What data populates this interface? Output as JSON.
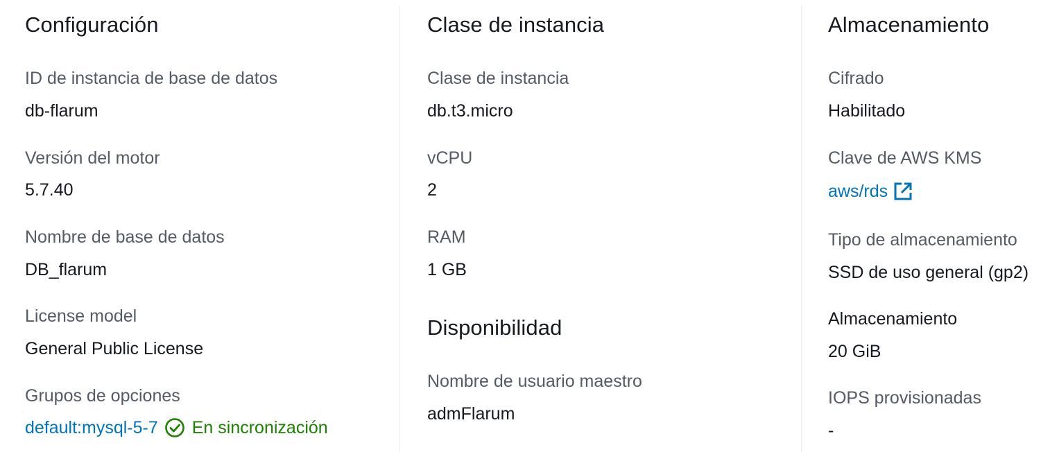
{
  "configuration": {
    "heading": "Configuración",
    "fields": [
      {
        "label": "ID de instancia de base de datos",
        "value": "db-flarum"
      },
      {
        "label": "Versión del motor",
        "value": "5.7.40"
      },
      {
        "label": "Nombre de base de datos",
        "value": "DB_flarum"
      },
      {
        "label": "License model",
        "value": "General Public License"
      },
      {
        "label": "Grupos de opciones",
        "link": "default:mysql-5-7",
        "status": "En sincronización"
      }
    ]
  },
  "instance_class": {
    "heading": "Clase de instancia",
    "fields": [
      {
        "label": "Clase de instancia",
        "value": "db.t3.micro"
      },
      {
        "label": "vCPU",
        "value": "2"
      },
      {
        "label": "RAM",
        "value": "1 GB"
      }
    ]
  },
  "availability": {
    "heading": "Disponibilidad",
    "fields": [
      {
        "label": "Nombre de usuario maestro",
        "value": "admFlarum"
      }
    ]
  },
  "storage": {
    "heading": "Almacenamiento",
    "fields": [
      {
        "label": "Cifrado",
        "value": "Habilitado"
      },
      {
        "label": "Clave de AWS KMS",
        "link": "aws/rds",
        "icon": "external-link-icon"
      },
      {
        "label": "Tipo de almacenamiento",
        "value": "SSD de uso general (gp2)"
      },
      {
        "label": "Almacenamiento",
        "value": "20 GiB"
      },
      {
        "label": "IOPS provisionadas",
        "value": "-"
      }
    ]
  },
  "colors": {
    "link": "#0073bb",
    "success": "#1d8102",
    "label": "#545b64",
    "text": "#16191f"
  }
}
